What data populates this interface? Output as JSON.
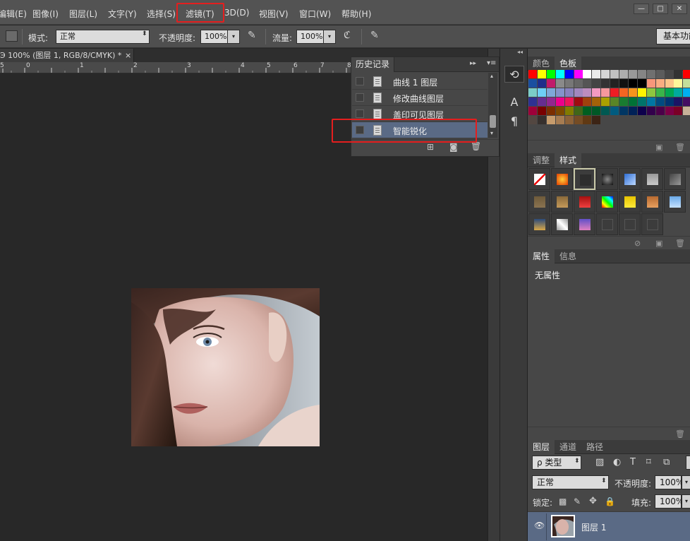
{
  "menu": [
    "编辑(E)",
    "图像(I)",
    "图层(L)",
    "文字(Y)",
    "选择(S)",
    "滤镜(T)",
    "3D(D)",
    "视图(V)",
    "窗口(W)",
    "帮助(H)"
  ],
  "window_controls": {
    "minimize": "—",
    "restore": "□",
    "close": "✕"
  },
  "options": {
    "mode_label": "模式:",
    "mode_value": "正常",
    "opacity_label": "不透明度:",
    "opacity_value": "100%",
    "flow_label": "流量:",
    "flow_value": "100%",
    "workspace": "基本功能"
  },
  "document": {
    "tab_title": "Э 100% (图层 1, RGB/8/CMYK) *",
    "tab_close": "×",
    "ruler_ticks": [
      "5",
      "0",
      "1",
      "2",
      "3",
      "4",
      "5",
      "6",
      "7",
      "8"
    ]
  },
  "history": {
    "tab": "历史记录",
    "items": [
      {
        "label": "曲线 1 图层"
      },
      {
        "label": "修改曲线图层"
      },
      {
        "label": "盖印可见图层"
      },
      {
        "label": "智能锐化",
        "selected": true
      }
    ]
  },
  "color_panel": {
    "tabs": [
      "颜色",
      "色板"
    ],
    "active": "色板"
  },
  "adjust_panel": {
    "tabs": [
      "调整",
      "样式"
    ],
    "active": "样式"
  },
  "props_panel": {
    "tabs": [
      "属性",
      "信息"
    ],
    "active": "属性",
    "content": "无属性"
  },
  "layers_panel": {
    "tabs": [
      "图层",
      "通道",
      "路径"
    ],
    "active": "图层",
    "filter": "ρ 类型",
    "blend_mode": "正常",
    "opacity_label": "不透明度:",
    "opacity_value": "100%",
    "lock_label": "锁定:",
    "fill_label": "填充:",
    "fill_value": "100%",
    "layers": [
      {
        "name": "图层 1",
        "visible": true
      }
    ]
  },
  "colors": {
    "accent_red": "#e41e1e",
    "selected_row": "#5a6a85",
    "bg": "#282828"
  }
}
